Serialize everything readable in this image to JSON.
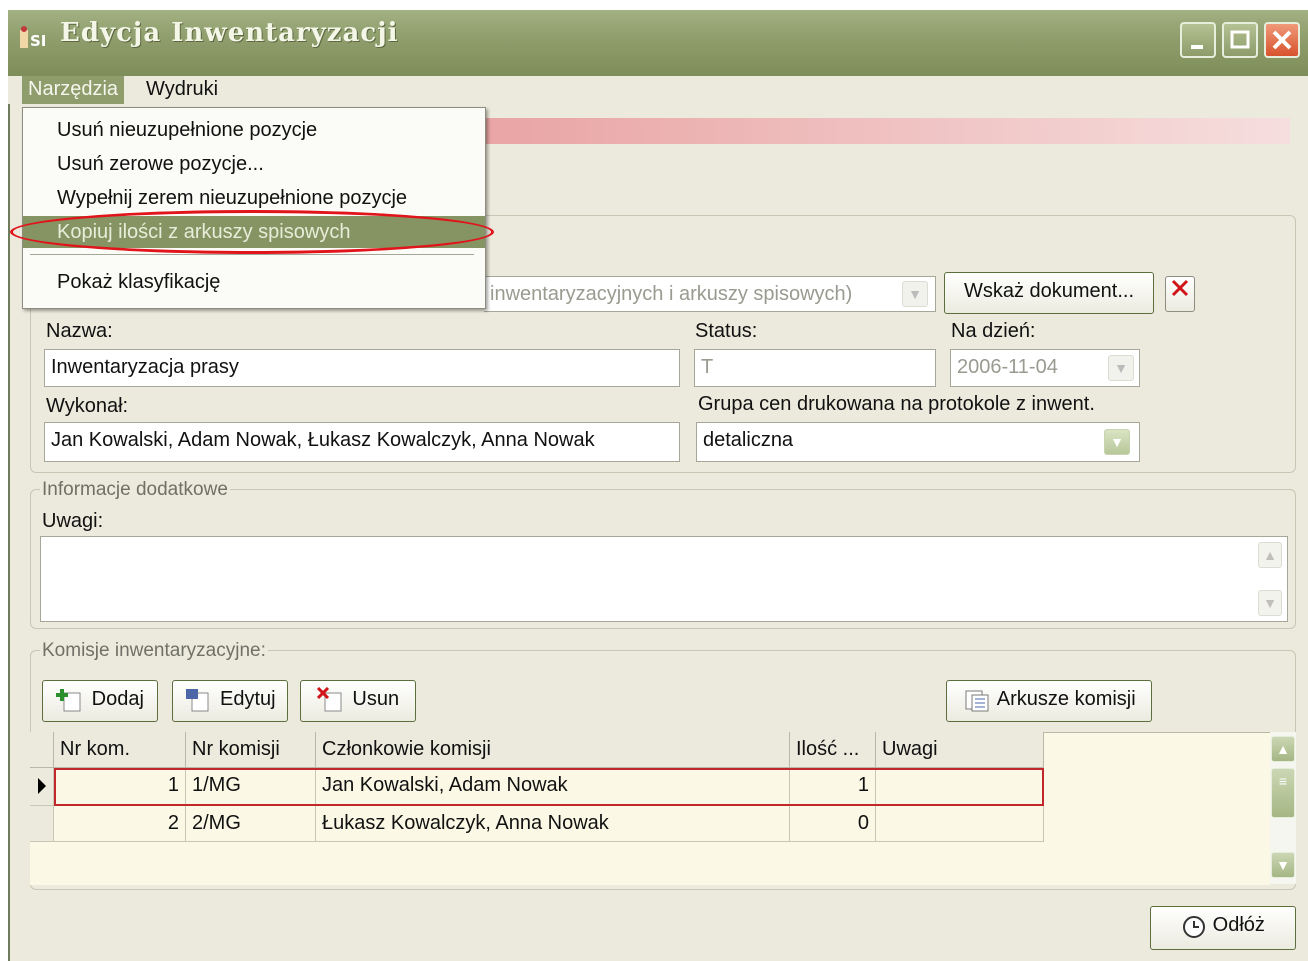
{
  "window": {
    "title": "Edycja Inwentaryzacji",
    "icon": "app-icon"
  },
  "menubar": {
    "items": [
      "Narzędzia",
      "Wydruki"
    ]
  },
  "dropdown": {
    "items": [
      "Usuń nieuzupełnione pozycje",
      "Usuń zerowe pozycje...",
      "Wypełnij zerem nieuzupełnione pozycje",
      "Kopiuj ilości z arkuszy spisowych",
      "Pokaż klasyfikację"
    ],
    "highlighted_index": 3
  },
  "document": {
    "combo_text": "inwentaryzacyjnych i arkuszy spisowych)",
    "button_label": "Wskaż dokument...",
    "clear_icon": "x-icon"
  },
  "fields": {
    "nazwa_label": "Nazwa:",
    "nazwa_value": "Inwentaryzacja prasy",
    "status_label": "Status:",
    "status_value": "T",
    "date_label": "Na dzień:",
    "date_value": "2006-11-04",
    "wykonal_label": "Wykonał:",
    "wykonal_value": "Jan Kowalski, Adam Nowak, Łukasz Kowalczyk, Anna Nowak",
    "grupa_label": "Grupa cen drukowana na protokole z inwent.",
    "grupa_value": "detaliczna"
  },
  "info": {
    "title": "Informacje dodatkowe",
    "uwagi_label": "Uwagi:",
    "uwagi_value": ""
  },
  "komisje": {
    "title": "Komisje inwentaryzacyjne:",
    "buttons": {
      "add": "Dodaj",
      "edit": "Edytuj",
      "delete": "Usun",
      "sheets": "Arkusze komisji"
    },
    "columns": [
      "Nr kom.",
      "Nr komisji",
      "Członkowie komisji",
      "Ilość ...",
      "Uwagi"
    ],
    "rows": [
      {
        "nr": "1",
        "nr_komisji": "1/MG",
        "czlonkowie": "Jan Kowalski, Adam Nowak",
        "ilosc": "1",
        "uwagi": ""
      },
      {
        "nr": "2",
        "nr_komisji": "2/MG",
        "czlonkowie": "Łukasz Kowalczyk, Anna Nowak",
        "ilosc": "0",
        "uwagi": ""
      }
    ],
    "selected_row": 0
  },
  "footer": {
    "button_label": "Odłóż"
  },
  "colors": {
    "titlebar": "#8e9d6b",
    "highlight": "#869464",
    "annotation": "#e0141a",
    "grid_bg": "#fbf9e6"
  }
}
